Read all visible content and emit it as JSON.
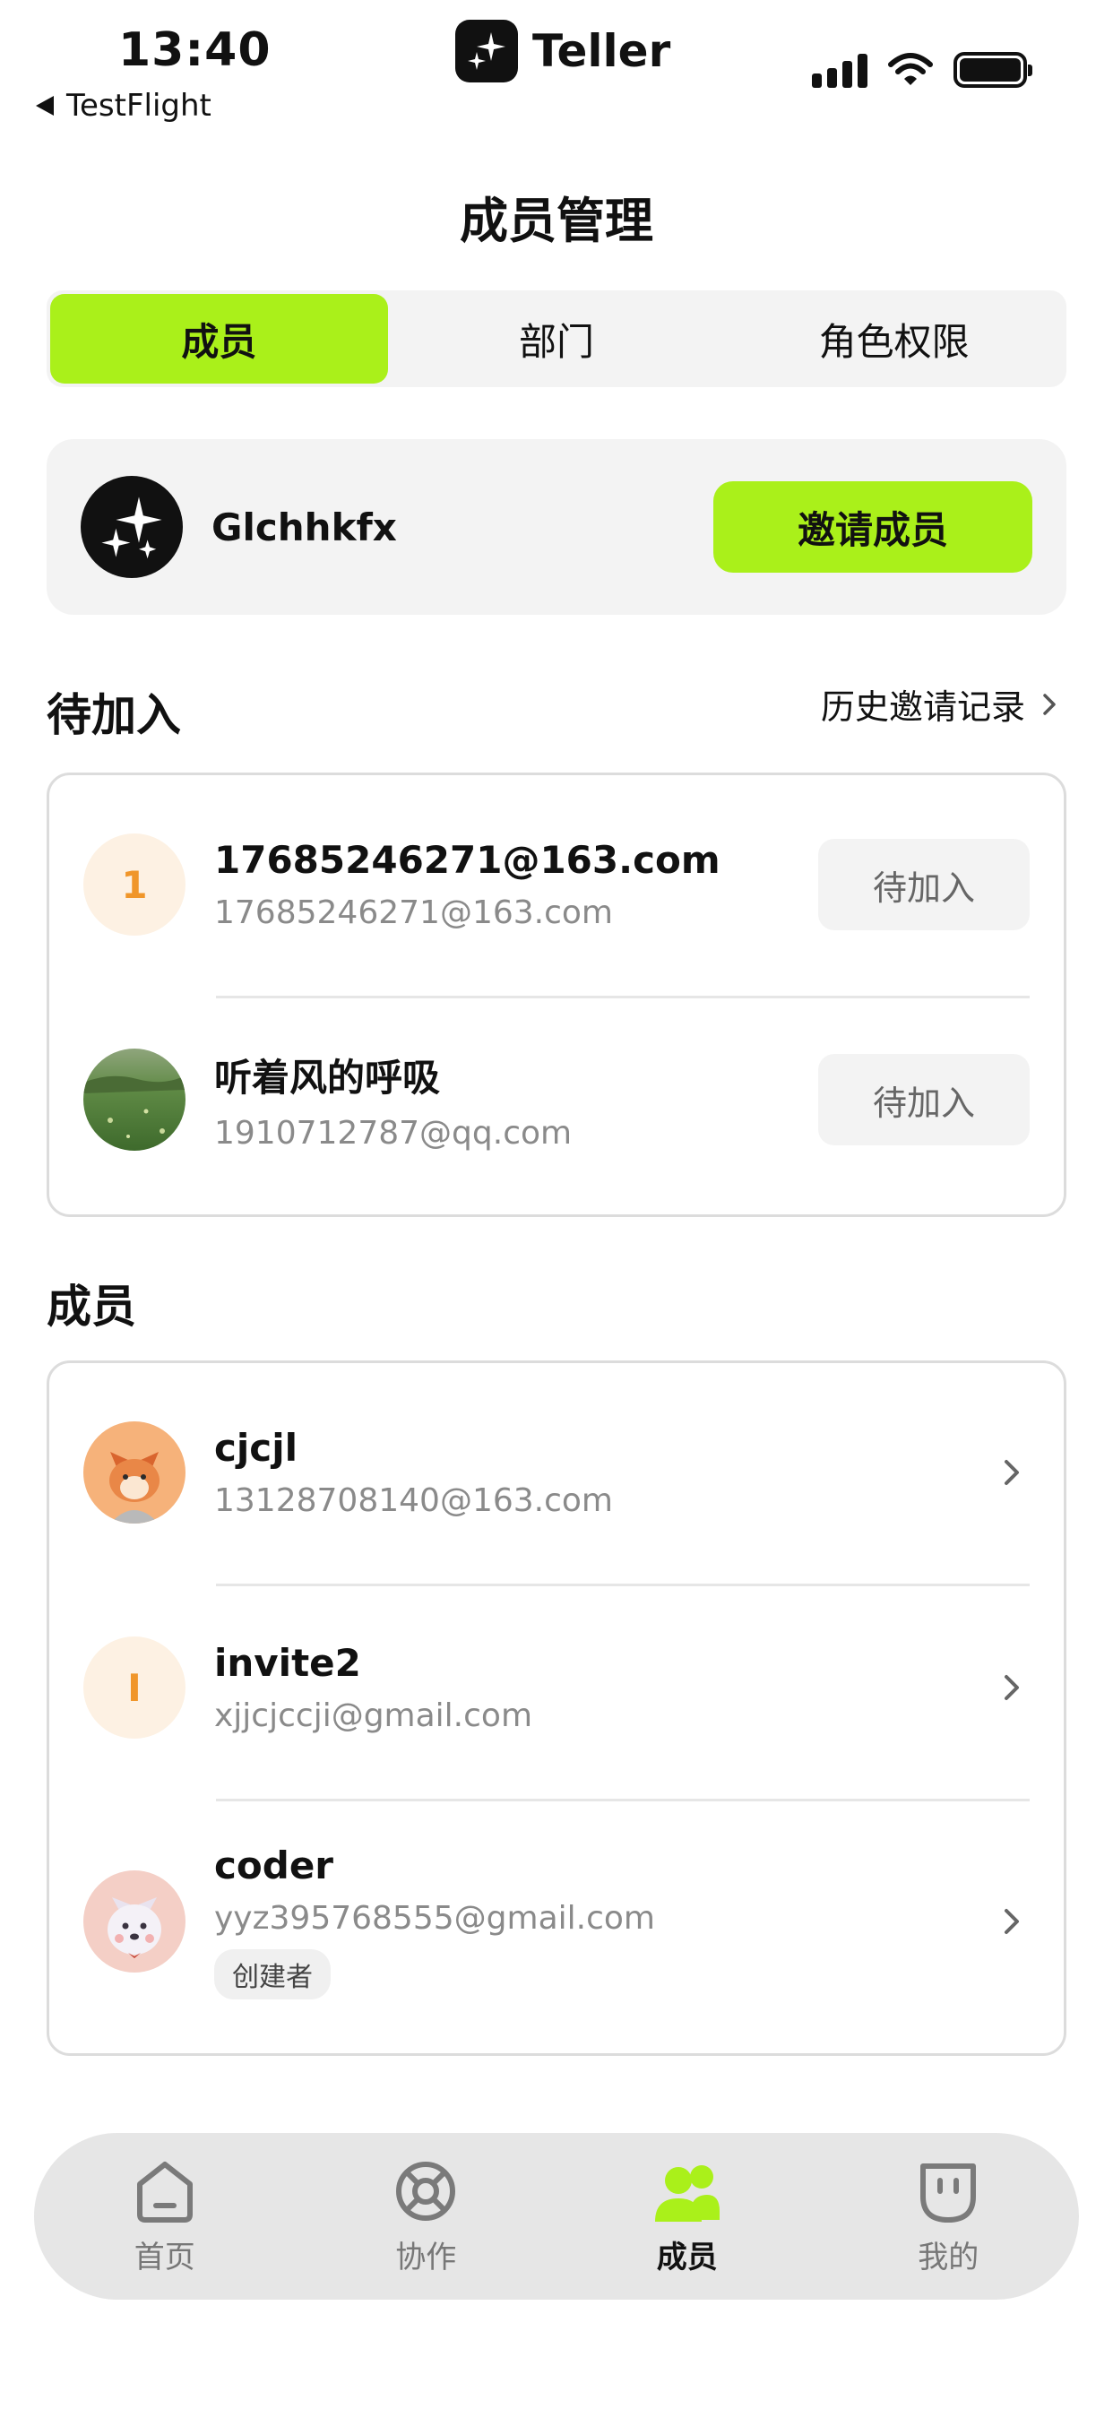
{
  "status_bar": {
    "time": "13:40",
    "back_app": "TestFlight",
    "app_name": "Teller"
  },
  "header": {
    "title": "成员管理"
  },
  "tabs": [
    {
      "label": "成员",
      "active": true
    },
    {
      "label": "部门",
      "active": false
    },
    {
      "label": "角色权限",
      "active": false
    }
  ],
  "org": {
    "name": "Glchhkfx",
    "invite_label": "邀请成员"
  },
  "pending": {
    "title": "待加入",
    "history_label": "历史邀请记录",
    "items": [
      {
        "avatar_letter": "1",
        "name": "17685246271@163.com",
        "email": "17685246271@163.com",
        "status": "待加入"
      },
      {
        "avatar_letter": "",
        "name": "听着风的呼吸",
        "email": "1910712787@qq.com",
        "status": "待加入"
      }
    ]
  },
  "members": {
    "title": "成员",
    "items": [
      {
        "avatar_letter": "",
        "name": "cjcjl",
        "email": "13128708140@163.com"
      },
      {
        "avatar_letter": "I",
        "name": "invite2",
        "email": "xjjcjccji@gmail.com"
      },
      {
        "avatar_letter": "",
        "name": "coder",
        "email": "yyz395768555@gmail.com",
        "badge": "创建者"
      }
    ]
  },
  "nav": [
    {
      "label": "首页",
      "icon": "home-icon",
      "active": false
    },
    {
      "label": "协作",
      "icon": "collab-icon",
      "active": false
    },
    {
      "label": "成员",
      "icon": "members-icon",
      "active": true
    },
    {
      "label": "我的",
      "icon": "profile-icon",
      "active": false
    }
  ],
  "colors": {
    "accent": "#aaf01a",
    "letter_avatar_bg": "#fdf1e3",
    "letter_avatar_fg": "#f0962a"
  }
}
